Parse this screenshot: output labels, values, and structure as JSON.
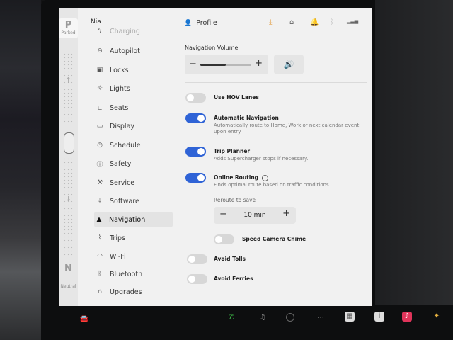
{
  "gear": {
    "park_letter": "P",
    "park_label": "Parked",
    "neutral_letter": "N",
    "neutral_label": "Neutral"
  },
  "sidebar": {
    "user": "Nia",
    "items": [
      {
        "label": "Charging",
        "icon": "bolt-icon"
      },
      {
        "label": "Autopilot",
        "icon": "steering-wheel-icon"
      },
      {
        "label": "Locks",
        "icon": "lock-icon"
      },
      {
        "label": "Lights",
        "icon": "sun-icon"
      },
      {
        "label": "Seats",
        "icon": "seat-icon"
      },
      {
        "label": "Display",
        "icon": "display-icon"
      },
      {
        "label": "Schedule",
        "icon": "clock-icon"
      },
      {
        "label": "Safety",
        "icon": "alert-icon"
      },
      {
        "label": "Service",
        "icon": "wrench-icon"
      },
      {
        "label": "Software",
        "icon": "download-icon"
      },
      {
        "label": "Navigation",
        "icon": "navigation-arrow-icon"
      },
      {
        "label": "Trips",
        "icon": "trips-icon"
      },
      {
        "label": "Wi-Fi",
        "icon": "wifi-icon"
      },
      {
        "label": "Bluetooth",
        "icon": "bluetooth-icon"
      },
      {
        "label": "Upgrades",
        "icon": "bag-icon"
      }
    ]
  },
  "topbar": {
    "profile_label": "Profile"
  },
  "navigation": {
    "volume_label": "Navigation Volume",
    "volume_level_fraction": 0.5,
    "options": [
      {
        "title": "Use HOV Lanes",
        "desc": "",
        "on": false
      },
      {
        "title": "Automatic Navigation",
        "desc": "Automatically route to Home, Work or next calendar event upon entry.",
        "on": true
      },
      {
        "title": "Trip Planner",
        "desc": "Adds Supercharger stops if necessary.",
        "on": true
      },
      {
        "title": "Online Routing",
        "desc": "Finds optimal route based on traffic conditions.",
        "on": true
      }
    ],
    "reroute_label": "Reroute to save",
    "reroute_value": "10 min",
    "stepper_minus": "−",
    "stepper_plus": "+",
    "speed_camera_label": "Speed Camera Chime",
    "avoid_tolls_label": "Avoid Tolls",
    "avoid_ferries_label": "Avoid Ferries"
  },
  "colors": {
    "toggle_on": "#2f63d6",
    "toggle_off": "#d7d7d7",
    "screen_bg": "#f1f1f1"
  }
}
